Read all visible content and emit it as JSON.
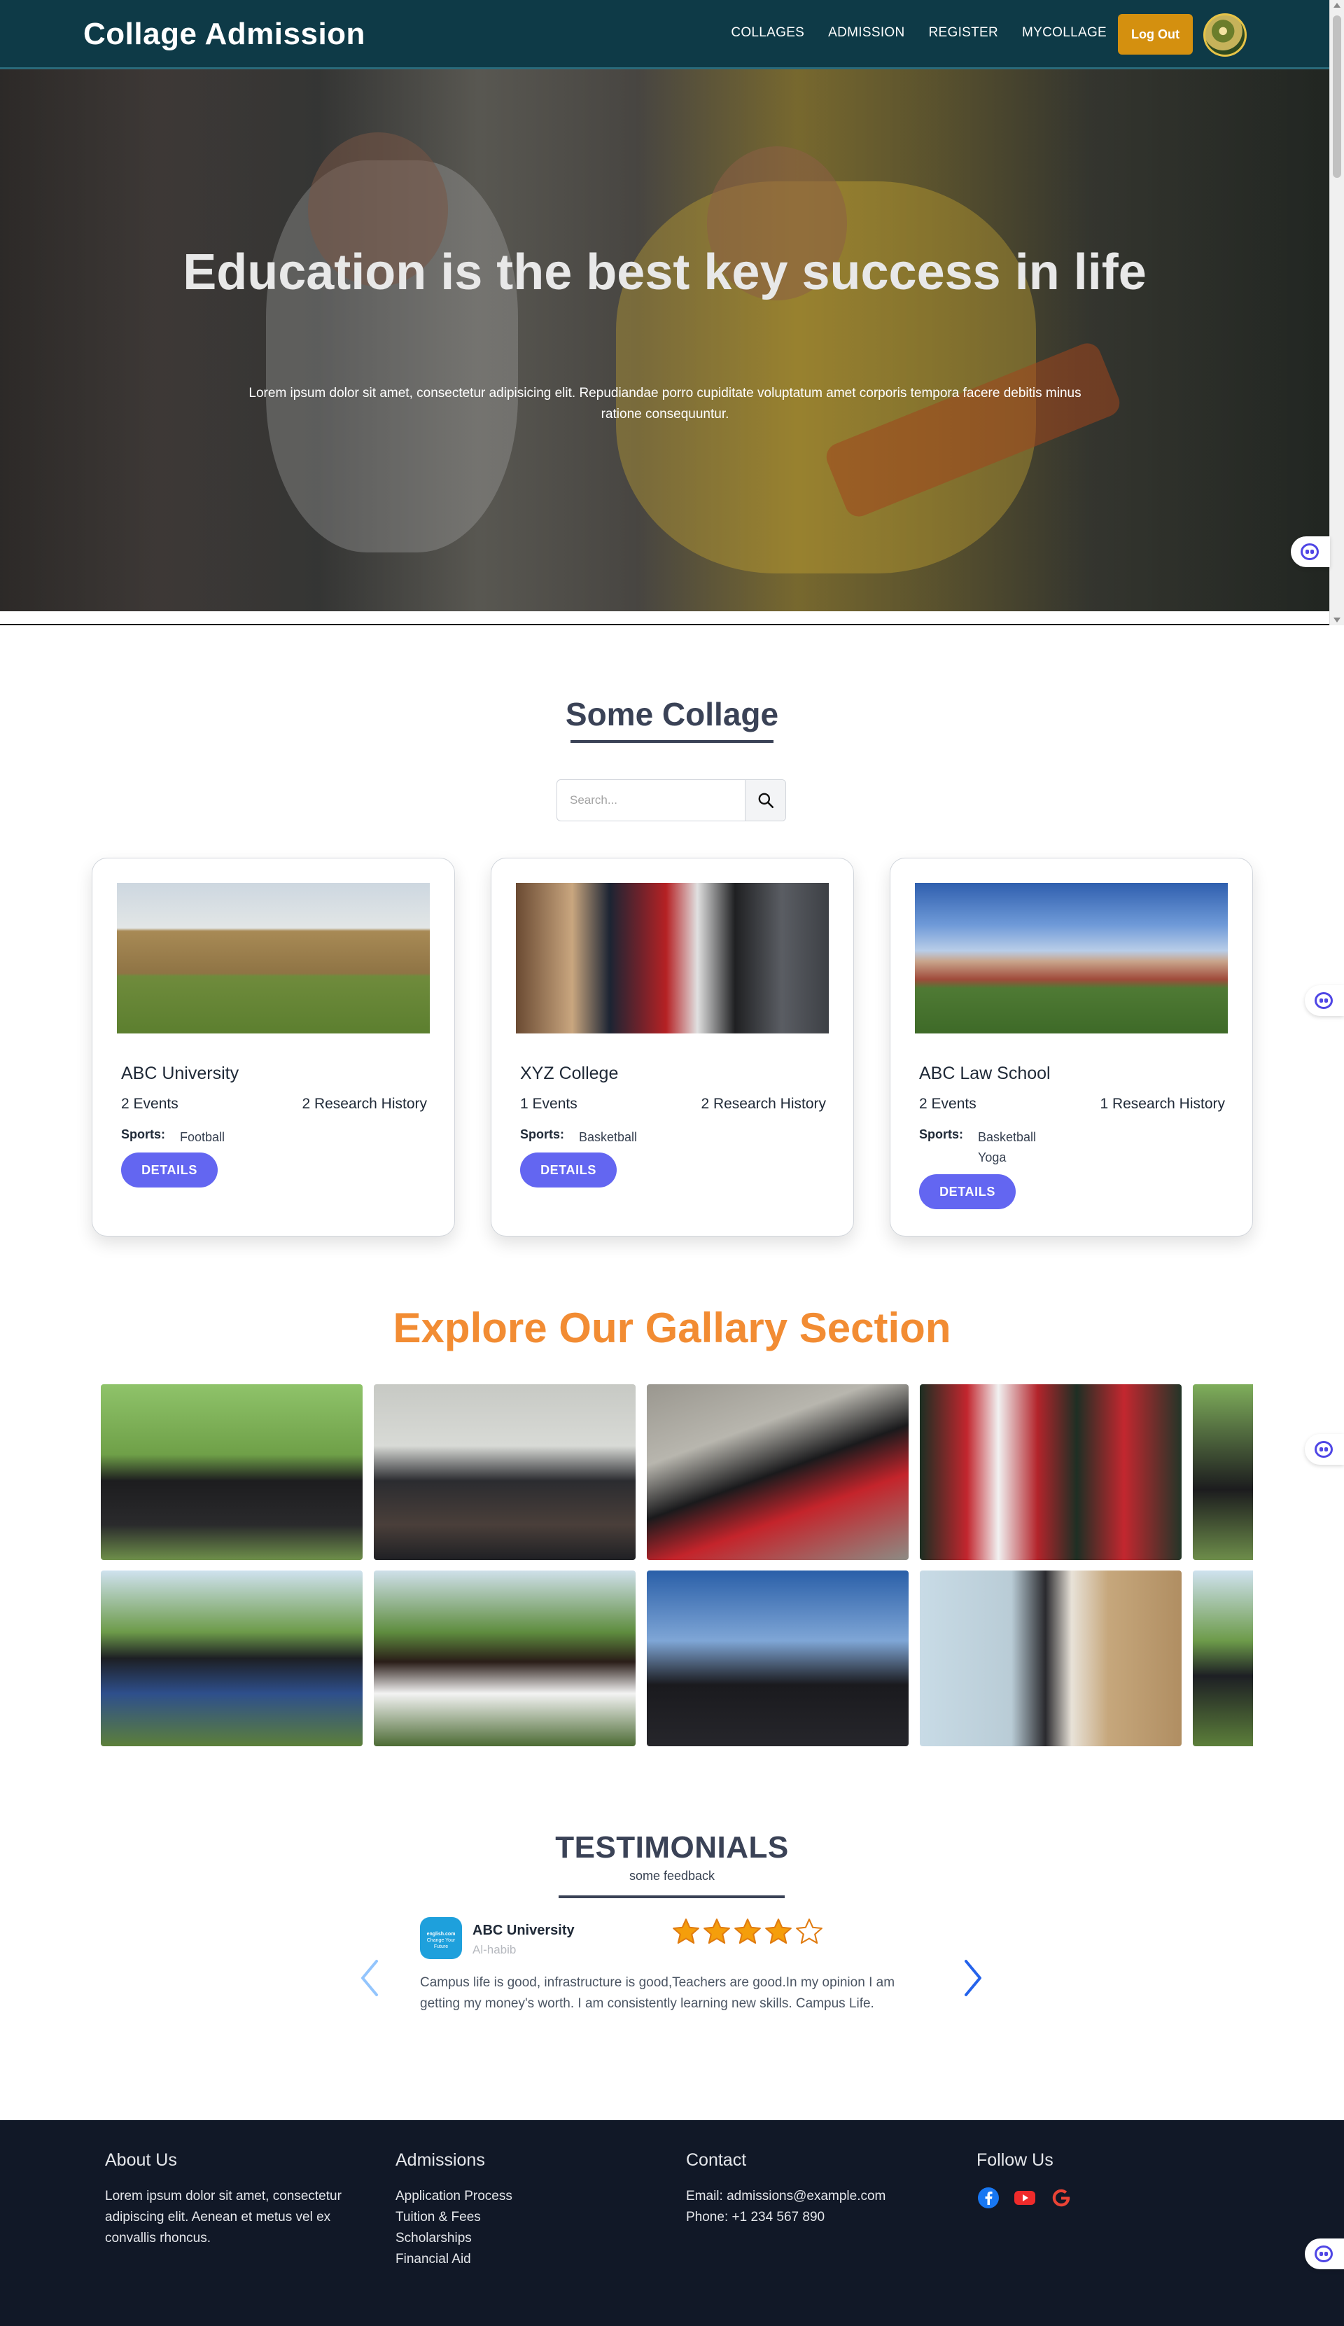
{
  "navbar": {
    "brand": "Collage Admission",
    "links": [
      "COLLAGES",
      "ADMISSION",
      "REGISTER",
      "MYCOLLAGE"
    ],
    "logout_label": "Log Out"
  },
  "hero": {
    "title": "Education is the best key success in life",
    "subtitle": "Lorem ipsum dolor sit amet, consectetur adipisicing elit. Repudiandae porro cupiditate voluptatum amet corporis tempora facere debitis minus ratione consequuntur."
  },
  "colleges_section": {
    "title": "Some Collage",
    "search_placeholder": "Search...",
    "cards": [
      {
        "name": "ABC University",
        "events": "2 Events",
        "research": "2 Research History",
        "sports_label": "Sports:",
        "sports": [
          "Football"
        ],
        "button": "DETAILS"
      },
      {
        "name": "XYZ College",
        "events": "1 Events",
        "research": "2 Research History",
        "sports_label": "Sports:",
        "sports": [
          "Basketball"
        ],
        "button": "DETAILS"
      },
      {
        "name": "ABC Law School",
        "events": "2 Events",
        "research": "1 Research History",
        "sports_label": "Sports:",
        "sports": [
          "Basketball",
          "Yoga"
        ],
        "button": "DETAILS"
      }
    ]
  },
  "gallery": {
    "title": "Explore Our Gallary Section",
    "images": [
      "graduate-sitting-photo",
      "caps-thrown-tent-photo",
      "graduate-steps-photo",
      "four-graduates-photo",
      "graduate-partial-photo",
      "graduate-confetti-photo",
      "graduate-smiling-photo",
      "caps-sky-photo",
      "graduate-building-photo",
      "graduate-partial-photo-2"
    ]
  },
  "testimonials": {
    "title": "TESTIMONIALS",
    "subtitle": "some feedback",
    "item": {
      "logo_text": "english.com",
      "logo_sub": "Change Your Future",
      "university": "ABC University",
      "author": "Al-habib",
      "rating": 4,
      "max_rating": 5,
      "text": "Campus life is good, infrastructure is good,Teachers are good.In my opinion I am getting my money's worth. I am consistently learning new skills. Campus Life."
    }
  },
  "footer": {
    "about": {
      "heading": "About Us",
      "text": "Lorem ipsum dolor sit amet, consectetur adipiscing elit. Aenean et metus vel ex convallis rhoncus."
    },
    "admissions": {
      "heading": "Admissions",
      "links": [
        "Application Process",
        "Tuition & Fees",
        "Scholarships",
        "Financial Aid"
      ]
    },
    "contact": {
      "heading": "Contact",
      "email": "Email: admissions@example.com",
      "phone": "Phone: +1 234 567 890"
    },
    "follow": {
      "heading": "Follow Us",
      "icons": [
        "facebook-icon",
        "youtube-icon",
        "google-icon"
      ]
    }
  },
  "colors": {
    "navbar": "#0e3a47",
    "logout": "#d4900f",
    "button": "#6366f1",
    "gallery_title": "#f28c33",
    "footer": "#111827",
    "star": "#f59e0b"
  }
}
